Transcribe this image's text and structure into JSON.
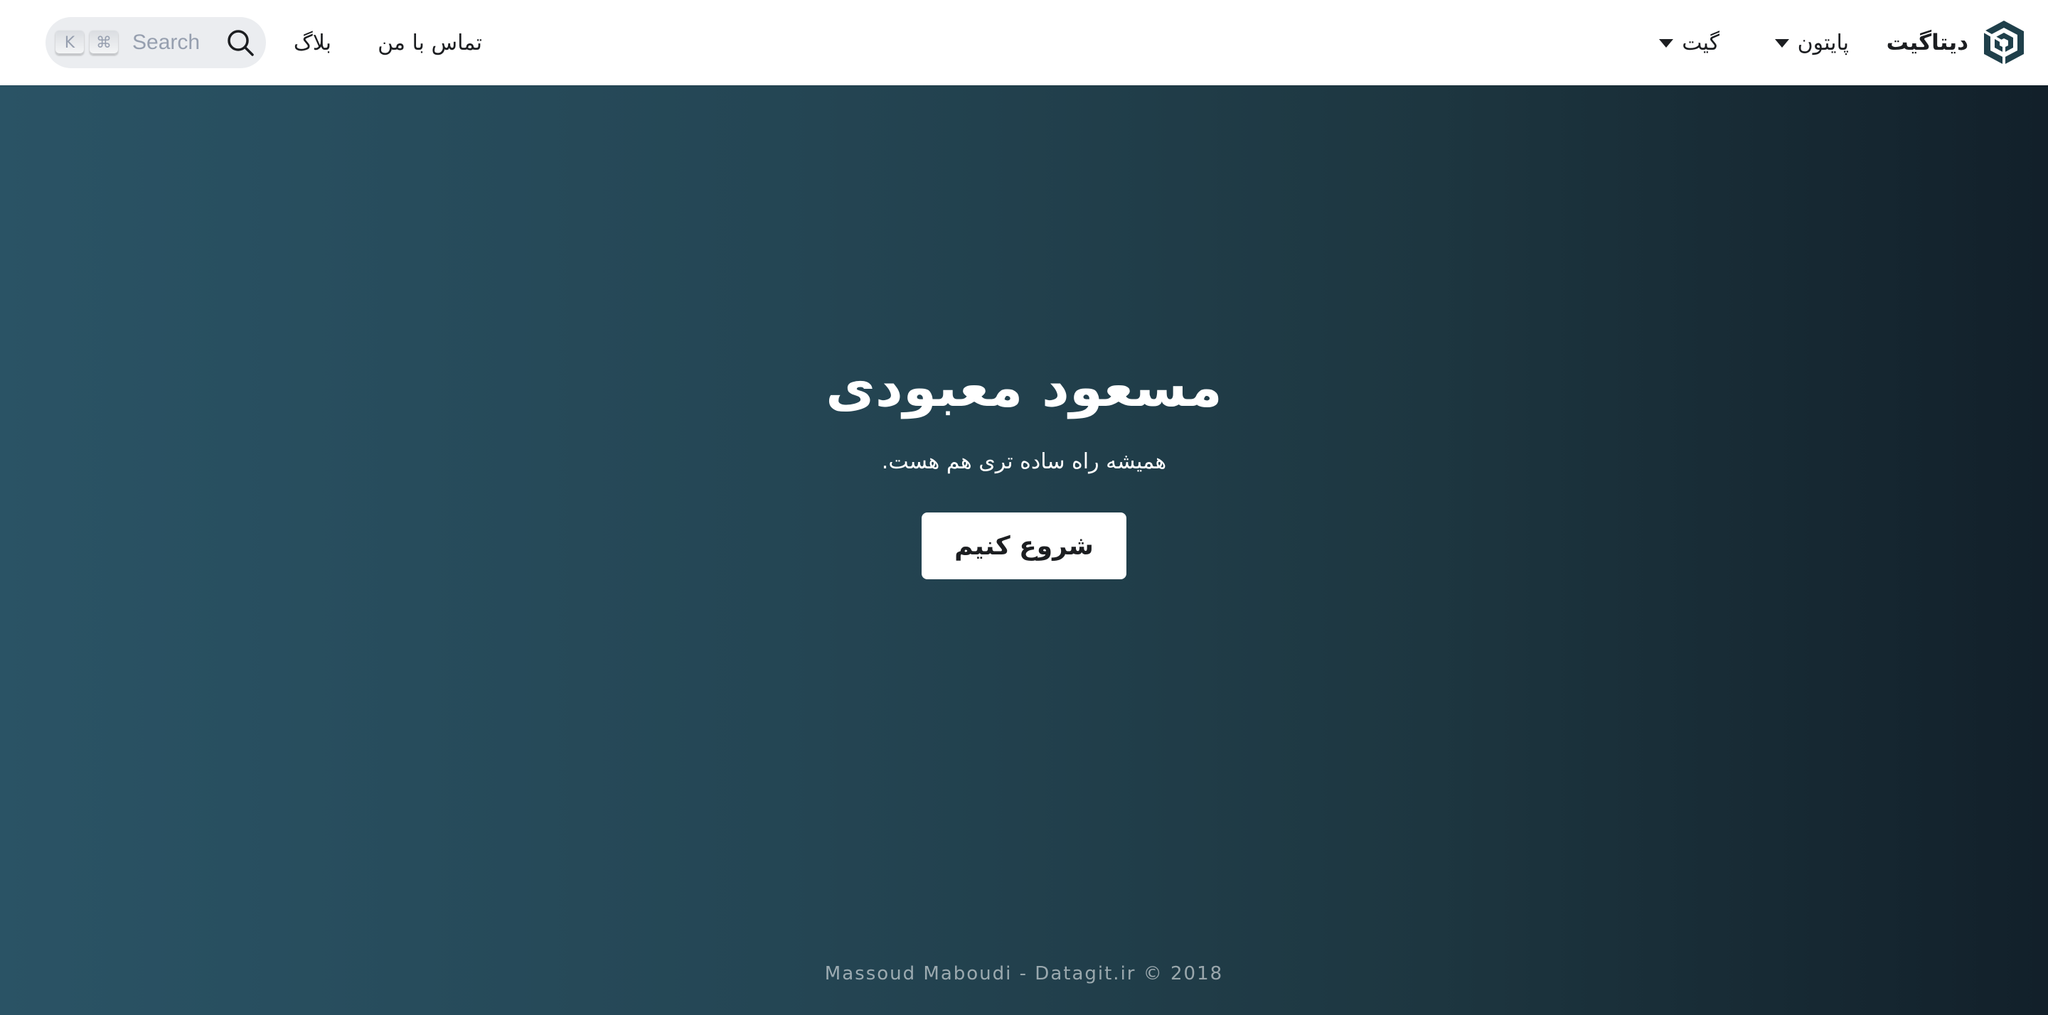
{
  "navbar": {
    "brand": {
      "title": "دیتاگیت",
      "logo_icon": "datagit-logo-icon"
    },
    "items": [
      {
        "label": "پایتون",
        "has_dropdown": true
      },
      {
        "label": "گیت",
        "has_dropdown": true
      },
      {
        "label": "تماس با من",
        "has_dropdown": false
      },
      {
        "label": "بلاگ",
        "has_dropdown": false
      }
    ],
    "search": {
      "placeholder": "Search",
      "icon": "search-icon",
      "shortcut_keys": [
        "⌘",
        "K"
      ]
    }
  },
  "hero": {
    "title": "مسعود معبودی",
    "subtitle": "همیشه راه ساده تری هم هست.",
    "cta_label": "شروع کنیم"
  },
  "footer": {
    "copyright": "Massoud Maboudi - Datagit.ir © 2018"
  },
  "colors": {
    "navbar_bg": "#ffffff",
    "hero_gradient_start": "#2a5365",
    "hero_gradient_end": "#12202a",
    "logo_color": "#1f3f4a",
    "text_dark": "#1c1e21",
    "search_bg": "#ebedf0"
  }
}
